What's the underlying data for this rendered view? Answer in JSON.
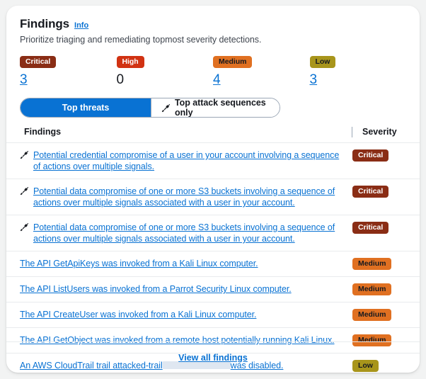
{
  "header": {
    "title": "Findings",
    "info_label": "Info",
    "subtitle": "Prioritize triaging and remediating topmost severity detections."
  },
  "summary": [
    {
      "label": "Critical",
      "count": "3",
      "severity": "critical",
      "is_link": true
    },
    {
      "label": "High",
      "count": "0",
      "severity": "high",
      "is_link": false
    },
    {
      "label": "Medium",
      "count": "4",
      "severity": "medium",
      "is_link": true
    },
    {
      "label": "Low",
      "count": "3",
      "severity": "low",
      "is_link": true
    }
  ],
  "segmented": {
    "top_threats_label": "Top threats",
    "attack_sequences_label": "Top attack sequences only",
    "attack_sequences_icon": "dart-icon",
    "active": "top_threats"
  },
  "table": {
    "col_findings": "Findings",
    "col_severity": "Severity",
    "rows": [
      {
        "text": "Potential credential compromise of a user in your account involving a sequence of actions over multiple signals.",
        "has_icon": true,
        "redacted": false,
        "severity_label": "Critical",
        "severity": "critical"
      },
      {
        "text": "Potential data compromise of one or more S3 buckets involving a sequence of actions over multiple signals associated with a user in your account.",
        "has_icon": true,
        "redacted": false,
        "severity_label": "Critical",
        "severity": "critical"
      },
      {
        "text": "Potential data compromise of one or more S3 buckets involving a sequence of actions over multiple signals associated with a user in your account.",
        "has_icon": true,
        "redacted": false,
        "severity_label": "Critical",
        "severity": "critical"
      },
      {
        "text": "The API GetApiKeys was invoked from a Kali Linux computer.",
        "has_icon": false,
        "redacted": false,
        "severity_label": "Medium",
        "severity": "medium"
      },
      {
        "text": "The API ListUsers was invoked from a Parrot Security Linux computer.",
        "has_icon": false,
        "redacted": false,
        "severity_label": "Medium",
        "severity": "medium"
      },
      {
        "text": "The API CreateUser was invoked from a Kali Linux computer.",
        "has_icon": false,
        "redacted": false,
        "severity_label": "Medium",
        "severity": "medium"
      },
      {
        "text": "The API GetObject was invoked from a remote host potentially running Kali Linux.",
        "has_icon": false,
        "redacted": false,
        "severity_label": "Medium",
        "severity": "medium"
      },
      {
        "text_before": "An AWS CloudTrail trail attacked-trail",
        "text_after": "was disabled.",
        "has_icon": false,
        "redacted": true,
        "severity_label": "Low",
        "severity": "low"
      }
    ]
  },
  "footer": {
    "view_all_label": "View all findings"
  },
  "colors": {
    "link": "#0972d3",
    "critical": "#8a2d15",
    "high": "#d13212",
    "medium": "#e07021",
    "low": "#a8951b",
    "page_bg": "#f2f3f3",
    "card_bg": "#ffffff",
    "divider": "#e9ebed",
    "text": "#16191f"
  }
}
